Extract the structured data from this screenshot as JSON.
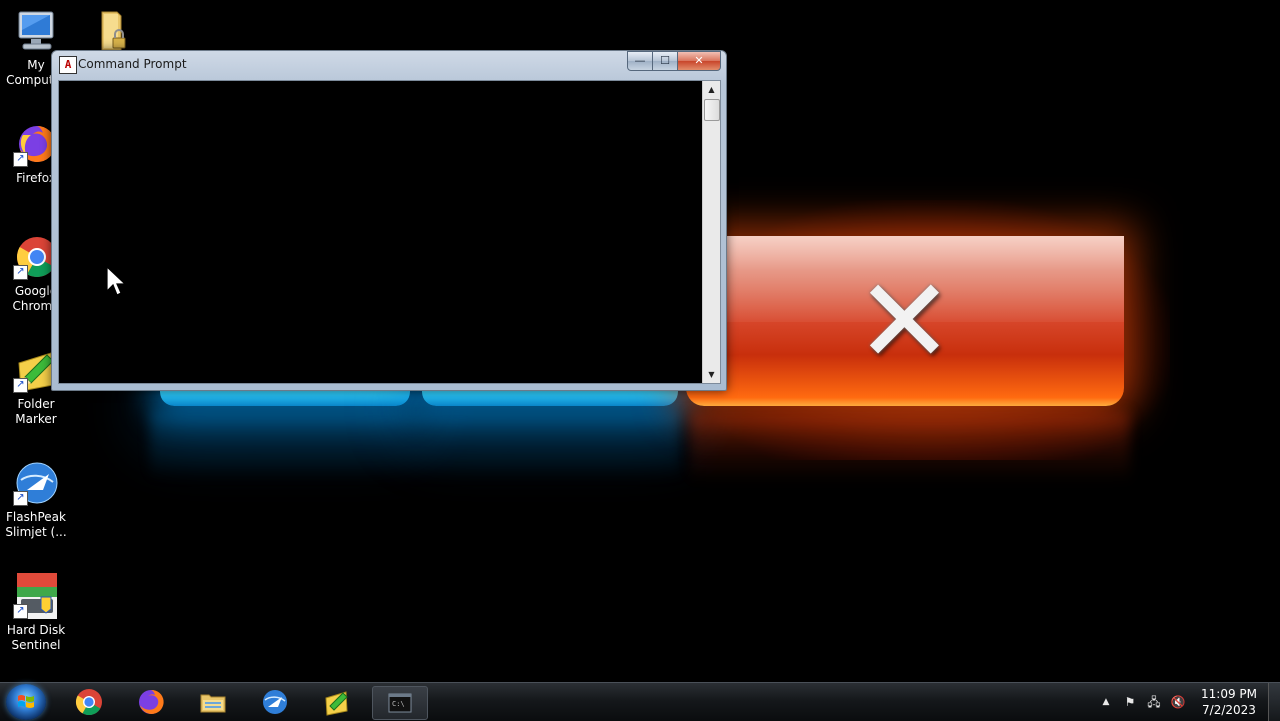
{
  "desktop": {
    "icons": [
      {
        "label": "My\nComputer",
        "icon": "computer-icon"
      },
      {
        "label": "",
        "icon": "locked-folder-icon"
      },
      {
        "label": "Firefox",
        "icon": "firefox-icon"
      },
      {
        "label": "Google\nChrome",
        "icon": "chrome-icon"
      },
      {
        "label": "Folder\nMarker",
        "icon": "folder-marker-icon"
      },
      {
        "label": "FlashPeak\nSlimjet (...",
        "icon": "slimjet-icon"
      },
      {
        "label": "Hard Disk\nSentinel",
        "icon": "hard-disk-sentinel-icon"
      }
    ]
  },
  "wallpaper": {
    "accent_red": "#d7462a",
    "accent_cyan": "#2fd0ff",
    "symbol": "✕"
  },
  "cmd_window": {
    "title": "Command Prompt",
    "app_icon_glyph": "A",
    "minimize_glyph": "—",
    "maximize_glyph": "☐",
    "close_glyph": "✕",
    "console_text": "",
    "scroll_up_glyph": "▲",
    "scroll_down_glyph": "▼"
  },
  "taskbar": {
    "start_label": "Start",
    "pinned": [
      {
        "name": "chrome",
        "icon": "chrome-icon"
      },
      {
        "name": "firefox",
        "icon": "firefox-icon"
      },
      {
        "name": "explorer",
        "icon": "file-explorer-icon"
      },
      {
        "name": "slimjet",
        "icon": "slimjet-icon"
      },
      {
        "name": "folder-marker",
        "icon": "folder-marker-icon"
      },
      {
        "name": "command-prompt",
        "icon": "cmd-icon"
      }
    ],
    "tray": {
      "show_hidden_glyph": "▲",
      "flag_glyph": "⚑",
      "network_glyph": "🖧",
      "volume_glyph": "🔇",
      "time": "11:09 PM",
      "date": "7/2/2023"
    }
  }
}
